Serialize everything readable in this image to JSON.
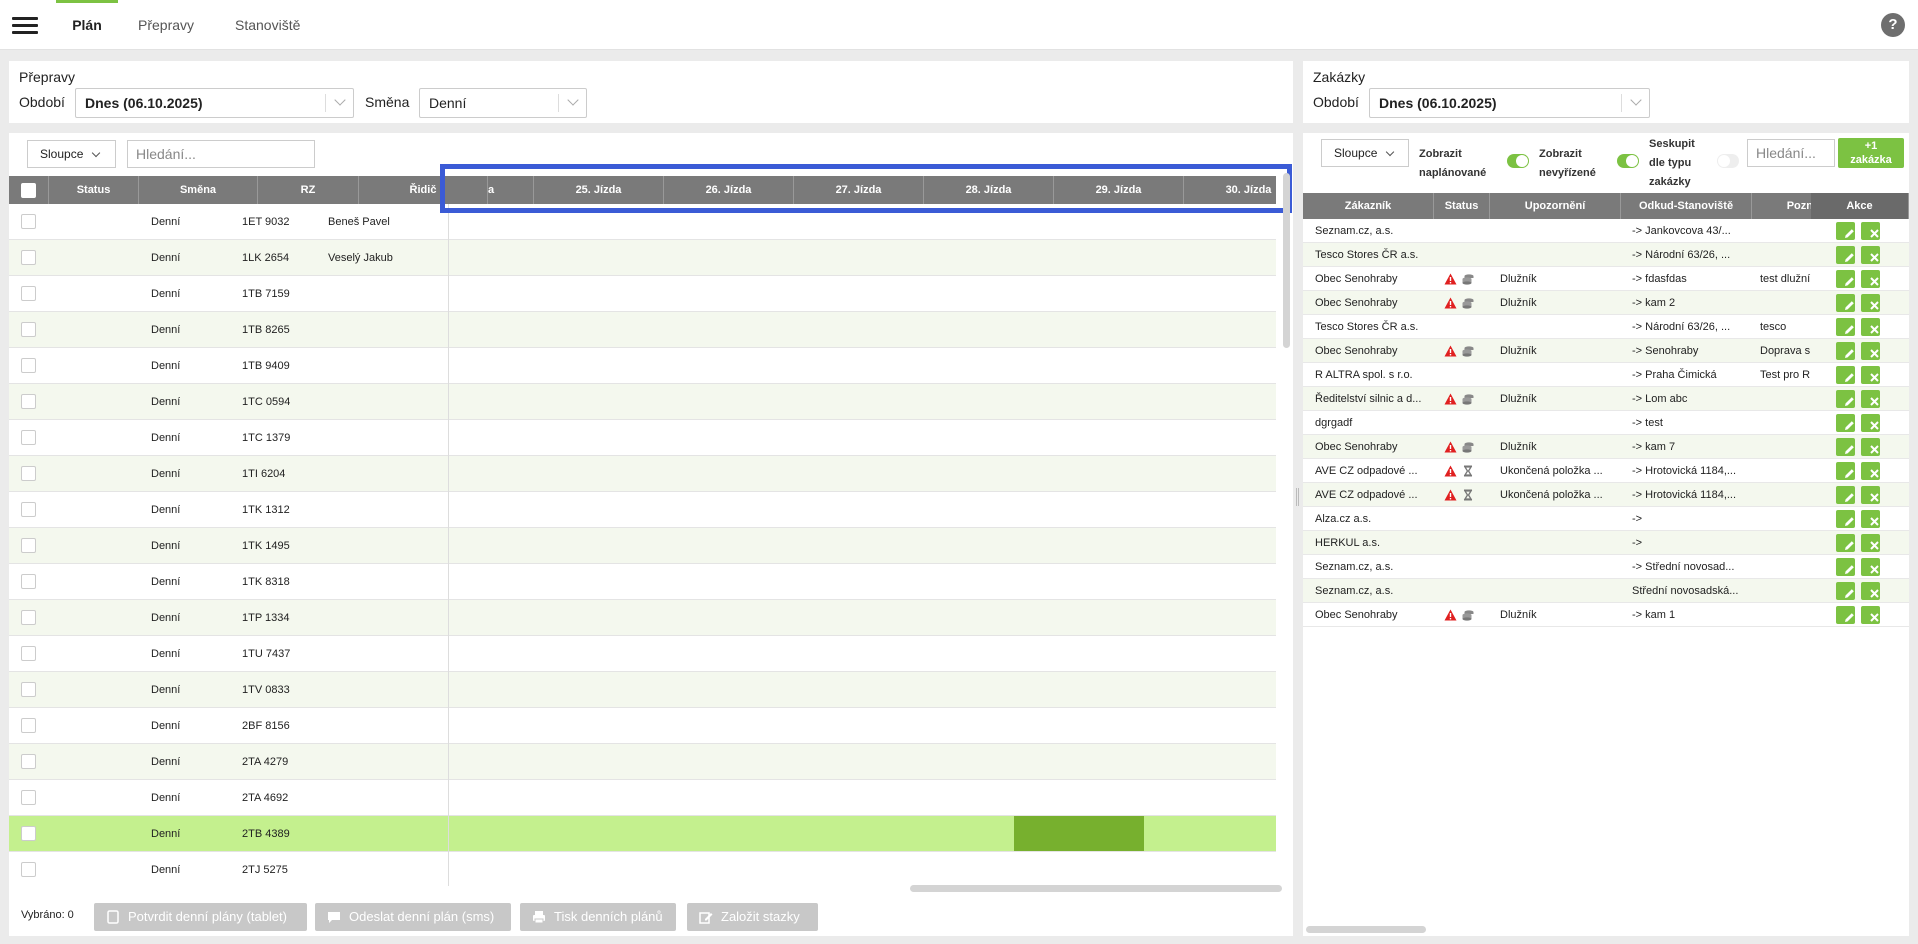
{
  "nav": {
    "tabs": [
      {
        "label": "Plán",
        "active": true
      },
      {
        "label": "Přepravy"
      },
      {
        "label": "Stanoviště"
      }
    ],
    "help_label": "?"
  },
  "left": {
    "title": "Přepravy",
    "period_label": "Období",
    "period_value": "Dnes (06.10.2025)",
    "shift_label": "Směna",
    "shift_value": "Denní",
    "columns_button": "Sloupce",
    "search_placeholder": "Hledání...",
    "headers": [
      "Status",
      "Směna",
      "RZ",
      "Řidič",
      "a",
      "25. Jízda",
      "26. Jízda",
      "27. Jízda",
      "28. Jízda",
      "29. Jízda",
      "30. Jízda"
    ],
    "rows": [
      {
        "shift": "Denní",
        "rz": "1ET 9032",
        "driver": "Beneš Pavel"
      },
      {
        "shift": "Denní",
        "rz": "1LK 2654",
        "driver": "Veselý Jakub"
      },
      {
        "shift": "Denní",
        "rz": "1TB 7159",
        "driver": ""
      },
      {
        "shift": "Denní",
        "rz": "1TB 8265",
        "driver": ""
      },
      {
        "shift": "Denní",
        "rz": "1TB 9409",
        "driver": ""
      },
      {
        "shift": "Denní",
        "rz": "1TC 0594",
        "driver": ""
      },
      {
        "shift": "Denní",
        "rz": "1TC 1379",
        "driver": ""
      },
      {
        "shift": "Denní",
        "rz": "1TI 6204",
        "driver": ""
      },
      {
        "shift": "Denní",
        "rz": "1TK 1312",
        "driver": ""
      },
      {
        "shift": "Denní",
        "rz": "1TK 1495",
        "driver": ""
      },
      {
        "shift": "Denní",
        "rz": "1TK 8318",
        "driver": ""
      },
      {
        "shift": "Denní",
        "rz": "1TP 1334",
        "driver": ""
      },
      {
        "shift": "Denní",
        "rz": "1TU 7437",
        "driver": ""
      },
      {
        "shift": "Denní",
        "rz": "1TV 0833",
        "driver": ""
      },
      {
        "shift": "Denní",
        "rz": "2BF 8156",
        "driver": ""
      },
      {
        "shift": "Denní",
        "rz": "2TA 4279",
        "driver": ""
      },
      {
        "shift": "Denní",
        "rz": "2TA 4692",
        "driver": ""
      },
      {
        "shift": "Denní",
        "rz": "2TB 4389",
        "driver": "",
        "selected": true
      },
      {
        "shift": "Denní",
        "rz": "2TJ 5275",
        "driver": ""
      }
    ],
    "footer": {
      "selected_label": "Vybráno: 0",
      "buttons": [
        "Potvrdit denní plány (tablet)",
        "Odeslat denní plán (sms)",
        "Tisk denních plánů",
        "Založit stazky"
      ]
    }
  },
  "right": {
    "title": "Zakázky",
    "period_label": "Období",
    "period_value": "Dnes (06.10.2025)",
    "columns_button": "Sloupce",
    "toggles": [
      {
        "label1": "Zobrazit",
        "label2": "naplánované",
        "on": true
      },
      {
        "label1": "Zobrazit",
        "label2": "nevyřízené",
        "on": true
      },
      {
        "label1": "Seskupit",
        "label2": "dle typu",
        "label3": "zakázky",
        "on": false
      }
    ],
    "search_placeholder": "Hledání...",
    "add_button_line1": "+1",
    "add_button_line2": "zakázka",
    "headers": [
      "Zákazník",
      "Status",
      "Upozornění",
      "Odkud-Stanoviště",
      "Pozn",
      "Akce"
    ],
    "rows": [
      {
        "customer": "Seznam.cz, a.s.",
        "status": "",
        "warning": "",
        "from": "-> Jankovcova 43/...",
        "note": ""
      },
      {
        "customer": "Tesco Stores ČR a.s.",
        "status": "",
        "warning": "",
        "from": "-> Národní 63/26, ...",
        "note": ""
      },
      {
        "customer": "Obec Senohraby",
        "status": "debt",
        "warning": "Dlužník",
        "from": "-> fdasfdas",
        "note": "test dlužní"
      },
      {
        "customer": "Obec Senohraby",
        "status": "debt",
        "warning": "Dlužník",
        "from": "-> kam 2",
        "note": ""
      },
      {
        "customer": "Tesco Stores ČR a.s.",
        "status": "",
        "warning": "",
        "from": "-> Národní 63/26, ...",
        "note": "tesco"
      },
      {
        "customer": "Obec Senohraby",
        "status": "debt",
        "warning": "Dlužník",
        "from": "-> Senohraby",
        "note": "Doprava s"
      },
      {
        "customer": "R ALTRA spol. s r.o.",
        "status": "",
        "warning": "",
        "from": "-> Praha Čimická",
        "note": "Test pro R"
      },
      {
        "customer": "Ředitelství silnic a d...",
        "status": "debt",
        "warning": "Dlužník",
        "from": "-> Lom abc",
        "note": ""
      },
      {
        "customer": "dgrgadf",
        "status": "",
        "warning": "",
        "from": "-> test",
        "note": ""
      },
      {
        "customer": "Obec Senohraby",
        "status": "debt",
        "warning": "Dlužník",
        "from": "-> kam 7",
        "note": ""
      },
      {
        "customer": "AVE CZ odpadové ...",
        "status": "ended",
        "warning": "Ukončená položka ...",
        "from": "-> Hrotovická 1184,...",
        "note": ""
      },
      {
        "customer": "AVE CZ odpadové ...",
        "status": "ended",
        "warning": "Ukončená položka ...",
        "from": "-> Hrotovická 1184,...",
        "note": ""
      },
      {
        "customer": "Alza.cz a.s.",
        "status": "",
        "warning": "",
        "from": "->",
        "note": ""
      },
      {
        "customer": "HERKUL a.s.",
        "status": "",
        "warning": "",
        "from": "->",
        "note": ""
      },
      {
        "customer": "Seznam.cz, a.s.",
        "status": "",
        "warning": "",
        "from": "-> Střední novosad...",
        "note": ""
      },
      {
        "customer": "Seznam.cz, a.s.",
        "status": "",
        "warning": "",
        "from": "Střední novosadská...",
        "note": ""
      },
      {
        "customer": "Obec Senohraby",
        "status": "debt",
        "warning": "Dlužník",
        "from": "-> kam 1",
        "note": ""
      }
    ]
  },
  "colors": {
    "accent": "#7cc242",
    "header_gray": "#7a7a7a",
    "selected_row": "#c4f08e",
    "planned_block": "#77b02e",
    "highlight_frame": "#3b5bd6",
    "warning_red": "#e02020"
  }
}
